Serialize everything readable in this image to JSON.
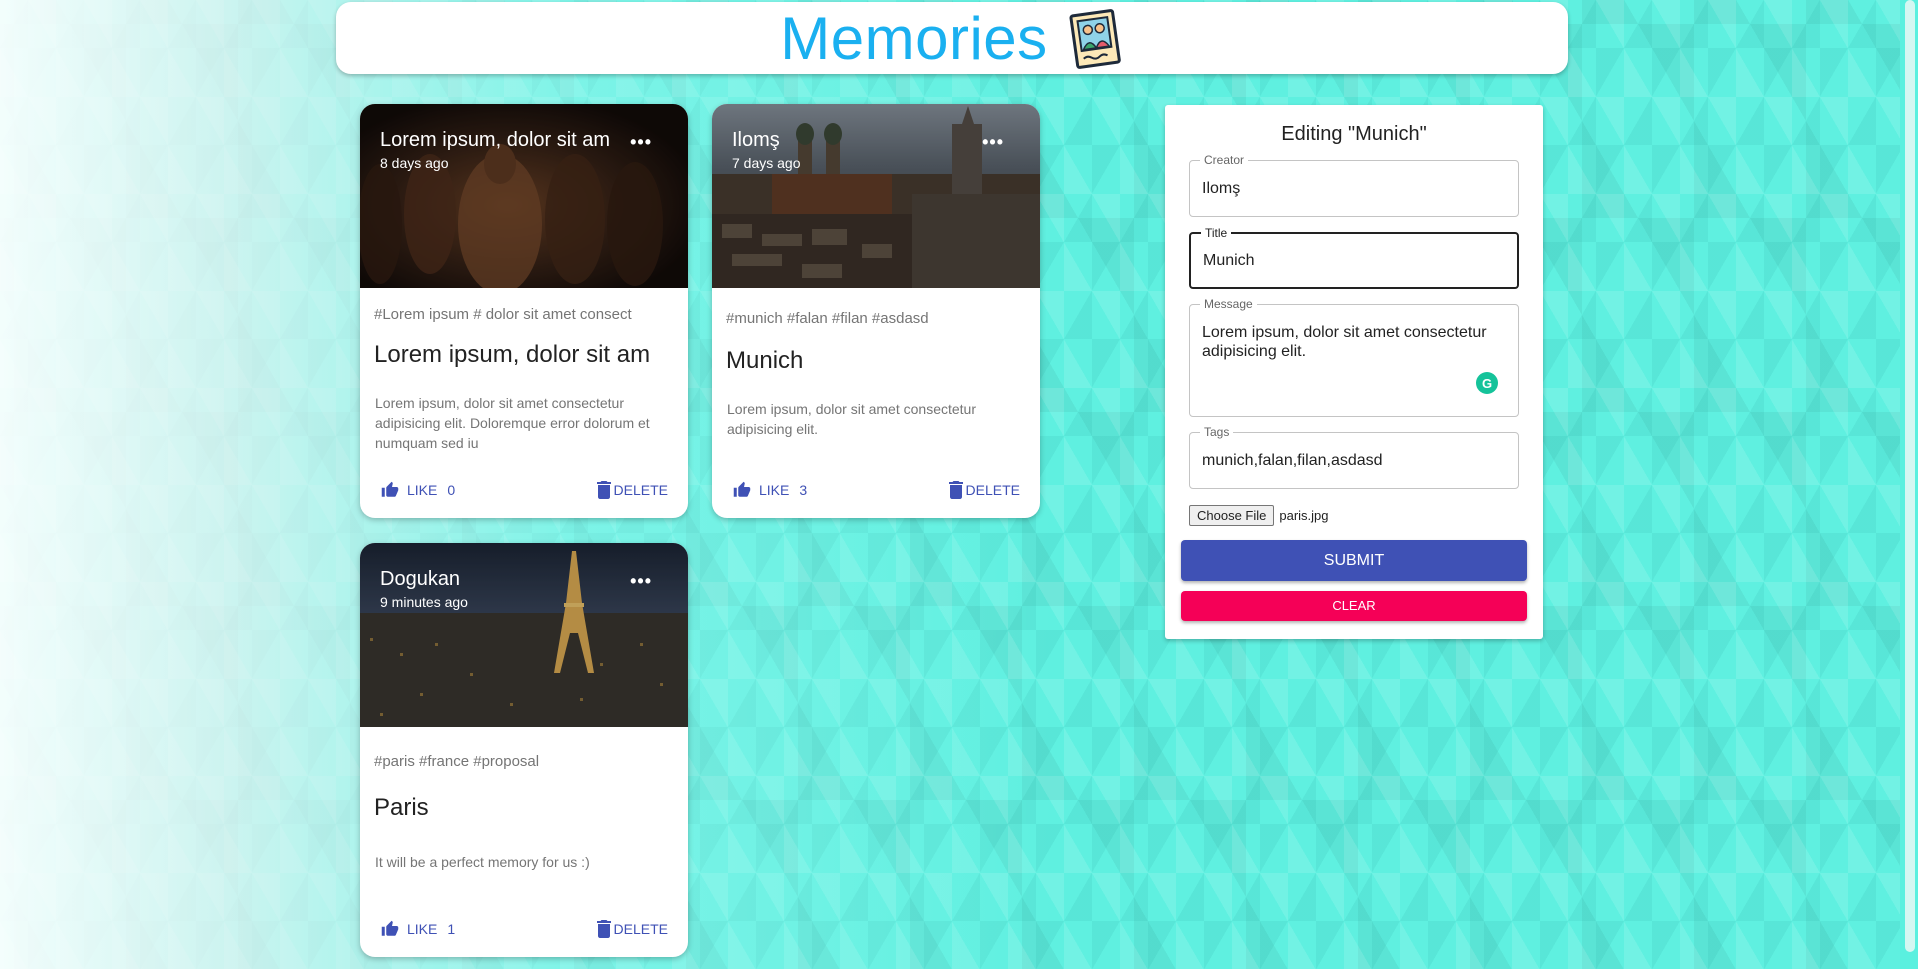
{
  "app": {
    "title": "Memories",
    "logo_icon": "memories-photo-icon",
    "accent_color": "#1ab0f0"
  },
  "posts": [
    {
      "author": "Lorem ipsum, dolor sit am",
      "time": "8 days ago",
      "tags": "#Lorem ipsum # dolor sit amet consect",
      "title": "Lorem ipsum, dolor sit am",
      "message": "Lorem ipsum, dolor sit amet consectetur adipisicing elit. Doloremque error dolorum et numquam sed iu",
      "like_label": "LIKE",
      "likes": "0",
      "delete_label": "DELETE",
      "image_icon": "crowd-photo"
    },
    {
      "author": "Ilomş",
      "time": "7 days ago",
      "tags": "#munich #falan #filan #asdasd",
      "title": "Munich",
      "message": "Lorem ipsum, dolor sit amet consectetur adipisicing elit.",
      "like_label": "LIKE",
      "likes": "3",
      "delete_label": "DELETE",
      "image_icon": "munich-city-photo"
    },
    {
      "author": "Dogukan",
      "time": "9 minutes ago",
      "tags": "#paris #france #proposal",
      "title": "Paris",
      "message": "It will be a perfect memory for us :)",
      "like_label": "LIKE",
      "likes": "1",
      "delete_label": "DELETE",
      "image_icon": "paris-night-photo"
    }
  ],
  "form": {
    "heading": "Editing \"Munich\"",
    "creator_label": "Creator",
    "creator_value": "Ilomş",
    "title_label": "Title",
    "title_value": "Munich",
    "message_label": "Message",
    "message_value": "Lorem ipsum, dolor sit amet consectetur adipisicing elit.",
    "tags_label": "Tags",
    "tags_value": "munich,falan,filan,asdasd",
    "file_button": "Choose File",
    "file_name": "paris.jpg",
    "submit_label": "SUBMIT",
    "clear_label": "CLEAR",
    "submit_color": "#3f51b5",
    "clear_color": "#f50057"
  }
}
